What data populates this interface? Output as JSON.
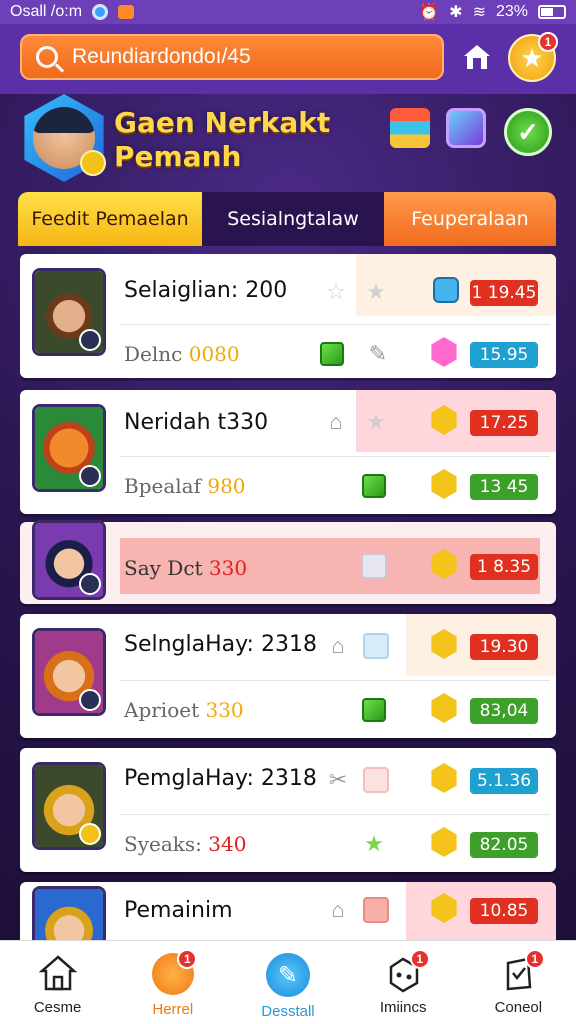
{
  "status_bar": {
    "left_text": "Osall /o:m",
    "right_text": "23%"
  },
  "search": {
    "placeholder": "Reundiardondoı/45"
  },
  "header": {
    "title_line1": "Gaen Nerkakt",
    "title_line2": "Pemanh"
  },
  "tabs": [
    {
      "label": "Feedit Pemaelan",
      "active": true
    },
    {
      "label": "Sesialngtalaw",
      "active": false
    },
    {
      "label": "Feuperalaan",
      "active": false
    }
  ],
  "items": [
    {
      "name": "Selaiglian: 200",
      "sub_prefix": "Delnc ",
      "sub_value": "0080",
      "top_value": "1 19.45",
      "bottom_value": "15.95",
      "top_color": "red",
      "bottom_color": "blue"
    },
    {
      "name": "Neridah t330",
      "sub_prefix": "Bpealaf ",
      "sub_value": "980",
      "top_value": "17.25",
      "bottom_value": "13 45",
      "top_color": "red",
      "bottom_color": "green"
    },
    {
      "name": "",
      "sub_prefix": "Say Dct ",
      "sub_value": "330",
      "top_value": "",
      "bottom_value": "1 8.35",
      "top_color": "red",
      "bottom_color": "red"
    },
    {
      "name": "SelnglaHay: 2318",
      "sub_prefix": "Aprioet ",
      "sub_value": "330",
      "top_value": "19.30",
      "bottom_value": "83,04",
      "top_color": "red",
      "bottom_color": "green"
    },
    {
      "name": "PemglaHay: 2318",
      "sub_prefix": "Syeaks: ",
      "sub_value": "340",
      "top_value": "5.1.36",
      "bottom_value": "82.05",
      "top_color": "blue",
      "bottom_color": "green"
    },
    {
      "name": "Pemainim",
      "sub_prefix": "",
      "sub_value": "",
      "top_value": "10.85",
      "bottom_value": "",
      "top_color": "red",
      "bottom_color": "red"
    }
  ],
  "bottom_nav": [
    {
      "label": "Cesme",
      "badge": ""
    },
    {
      "label": "Herrel",
      "badge": "1"
    },
    {
      "label": "Desstall",
      "badge": ""
    },
    {
      "label": "Imiincs",
      "badge": "1"
    },
    {
      "label": "Coneol",
      "badge": "1"
    }
  ],
  "badges": {
    "star_button": "1"
  },
  "colors": {
    "accent_orange": "#f06a1a",
    "accent_purple": "#5b2fa8",
    "gold": "#ffd84a"
  }
}
